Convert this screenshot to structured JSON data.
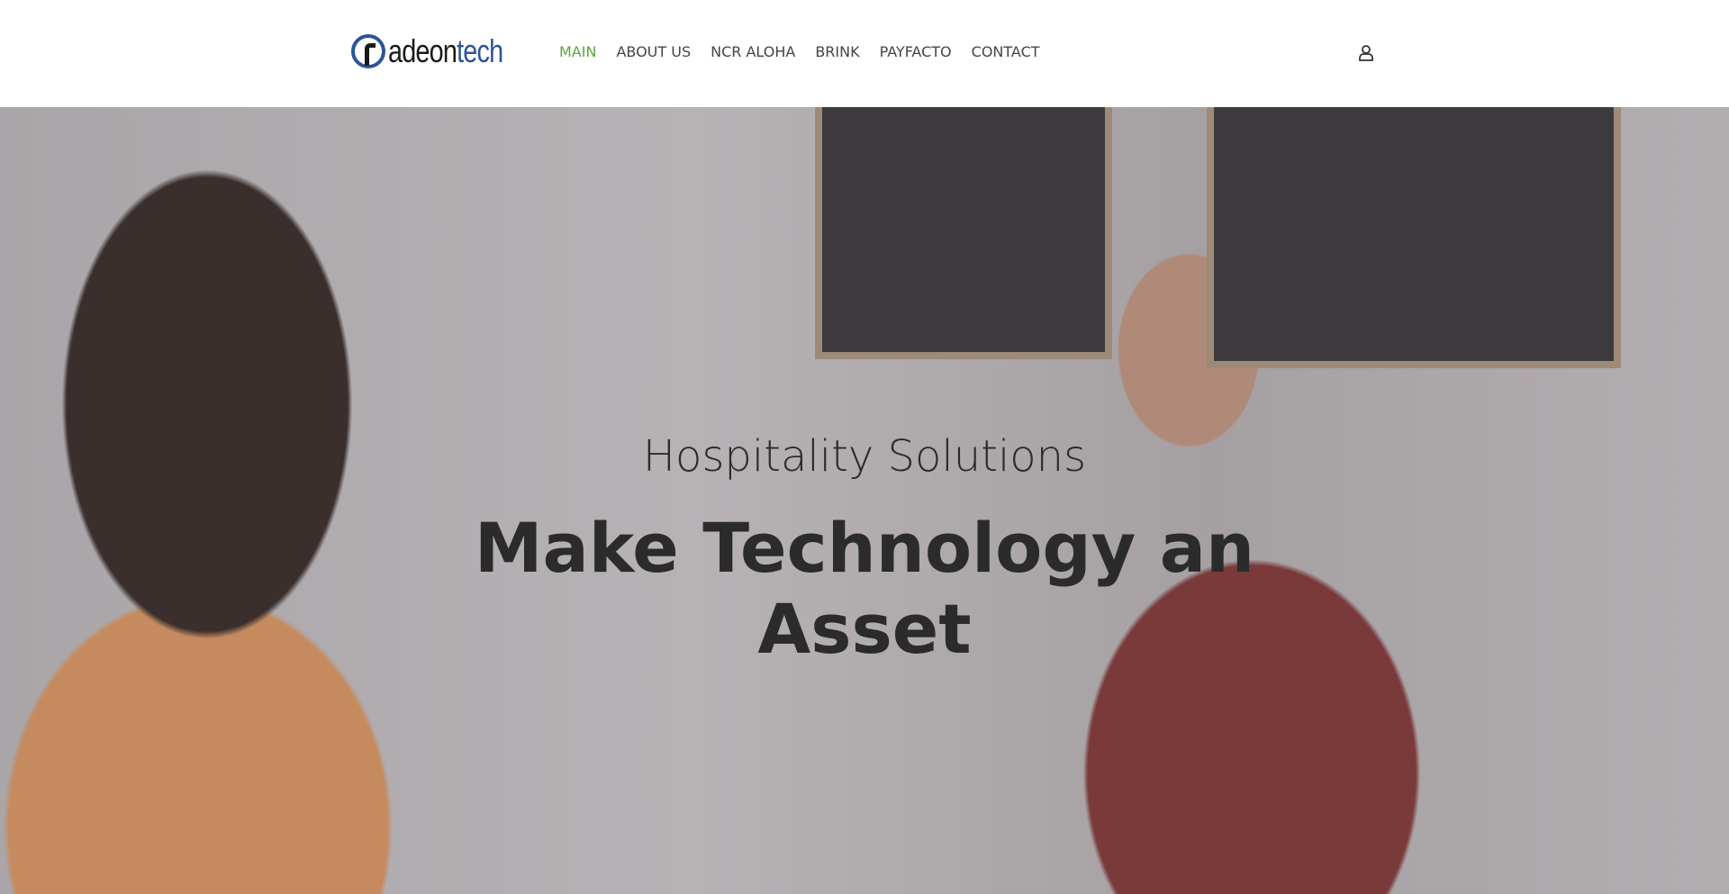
{
  "logo": {
    "text_a": "r",
    "text_b": "adeon",
    "text_c": "tech"
  },
  "nav": {
    "items": [
      {
        "label": "MAIN",
        "active": true
      },
      {
        "label": "ABOUT US"
      },
      {
        "label": "NCR ALOHA"
      },
      {
        "label": "BRINK"
      },
      {
        "label": "PAYFACTO"
      },
      {
        "label": "CONTACT"
      }
    ]
  },
  "header": {
    "user_icon": "user-icon"
  },
  "hero": {
    "subtitle": "Hospitality Solutions",
    "title_line1": "Make Technology an",
    "title_line2": "Asset"
  },
  "colors": {
    "accent": "#5aa53a",
    "brand": "#2a5596"
  }
}
